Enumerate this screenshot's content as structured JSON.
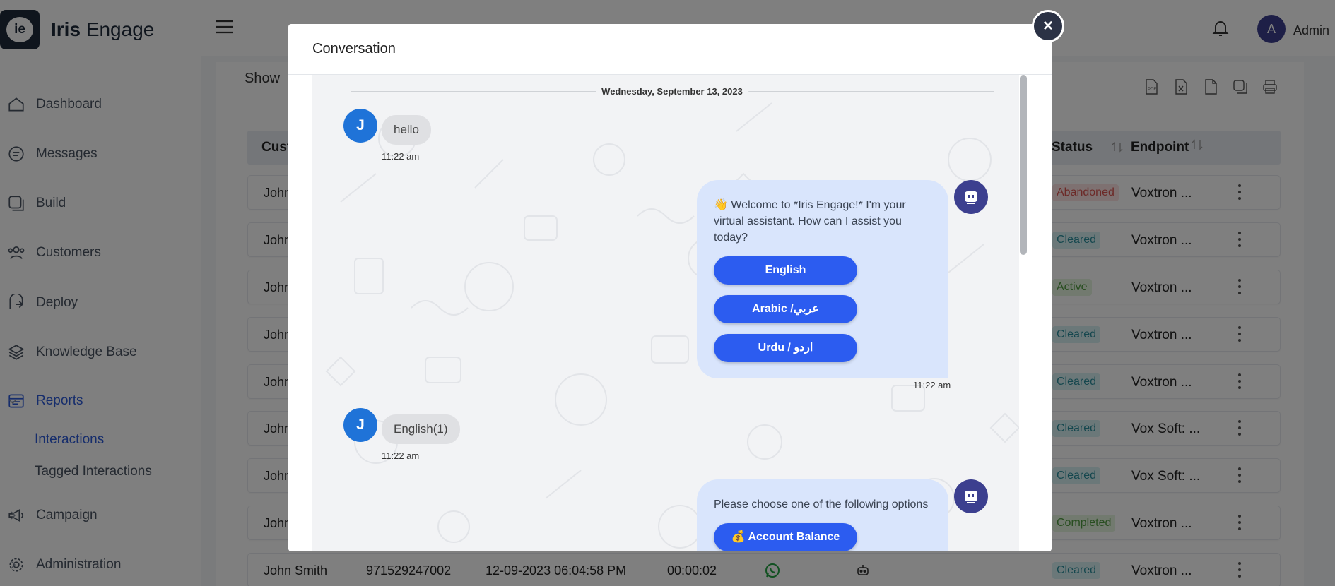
{
  "app": {
    "name_bold": "Iris",
    "name_light": "Engage",
    "logo_mark": "ie"
  },
  "user": {
    "avatar_initial": "A",
    "name": "Admin"
  },
  "sidebar": {
    "items": [
      {
        "label": "Dashboard",
        "icon": "home-icon"
      },
      {
        "label": "Messages",
        "icon": "messages-icon"
      },
      {
        "label": "Build",
        "icon": "build-icon"
      },
      {
        "label": "Customers",
        "icon": "customers-icon"
      },
      {
        "label": "Deploy",
        "icon": "deploy-icon"
      },
      {
        "label": "Knowledge Base",
        "icon": "layers-icon"
      },
      {
        "label": "Reports",
        "icon": "reports-icon"
      },
      {
        "label": "Campaign",
        "icon": "campaign-icon"
      },
      {
        "label": "Administration",
        "icon": "gear-icon"
      }
    ],
    "reports_sub": [
      {
        "label": "Interactions"
      },
      {
        "label": "Tagged Interactions"
      }
    ]
  },
  "main": {
    "show_label": "Show",
    "columns": {
      "customer": "Cust",
      "status": "Status",
      "endpoint": "Endpoint"
    },
    "rows": [
      {
        "customer": "John",
        "status": "Abandoned",
        "endpoint": "Voxtron ..."
      },
      {
        "customer": "John",
        "status": "Cleared",
        "endpoint": "Voxtron ..."
      },
      {
        "customer": "John",
        "status": "Active",
        "endpoint": "Voxtron ..."
      },
      {
        "customer": "John",
        "status": "Cleared",
        "endpoint": "Voxtron ..."
      },
      {
        "customer": "John",
        "status": "Cleared",
        "endpoint": "Voxtron ..."
      },
      {
        "customer": "John",
        "status": "Cleared",
        "endpoint": "Vox Soft: ..."
      },
      {
        "customer": "John",
        "status": "Cleared",
        "endpoint": "Vox Soft: ..."
      },
      {
        "customer": "John",
        "status": "Completed",
        "endpoint": "Voxtron ..."
      }
    ],
    "last_row": {
      "customer": "John Smith",
      "phone": "971529247002",
      "datetime": "12-09-2023 06:04:58 PM",
      "duration": "00:00:02",
      "status": "Cleared",
      "endpoint": "Voxtron ..."
    }
  },
  "modal": {
    "title": "Conversation",
    "close_label": "×",
    "date": "Wednesday, September 13, 2023",
    "messages": [
      {
        "from": "user",
        "initial": "J",
        "text": "hello",
        "time": "11:22 am"
      },
      {
        "from": "bot",
        "text": "👋 Welcome to *Iris Engage!* I'm your virtual assistant. How can I assist you today?",
        "buttons": [
          "English",
          "Arabic /عربي",
          "Urdu / اردو"
        ],
        "time": "11:22 am"
      },
      {
        "from": "user",
        "initial": "J",
        "text": "English(1)",
        "time": "11:22 am"
      },
      {
        "from": "bot",
        "text": "Please choose one of the following options",
        "buttons": [
          "💰 Account Balance"
        ]
      }
    ]
  },
  "colors": {
    "accent": "#2c5cf0",
    "avatar_user": "#1f73d8",
    "avatar_bot": "#3c3f8f",
    "bot_bubble": "#d9e5fc"
  }
}
